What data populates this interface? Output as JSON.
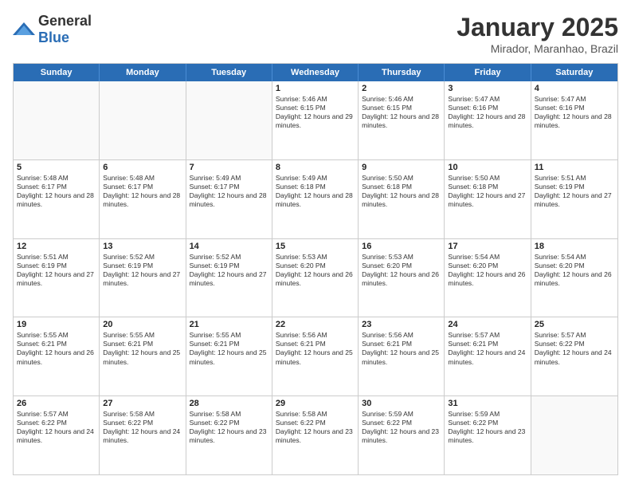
{
  "header": {
    "logo": {
      "general": "General",
      "blue": "Blue"
    },
    "title": "January 2025",
    "subtitle": "Mirador, Maranhao, Brazil"
  },
  "dayHeaders": [
    "Sunday",
    "Monday",
    "Tuesday",
    "Wednesday",
    "Thursday",
    "Friday",
    "Saturday"
  ],
  "weeks": [
    [
      {
        "day": "",
        "empty": true
      },
      {
        "day": "",
        "empty": true
      },
      {
        "day": "",
        "empty": true
      },
      {
        "day": "1",
        "sunrise": "5:46 AM",
        "sunset": "6:15 PM",
        "daylight": "12 hours and 29 minutes."
      },
      {
        "day": "2",
        "sunrise": "5:46 AM",
        "sunset": "6:15 PM",
        "daylight": "12 hours and 28 minutes."
      },
      {
        "day": "3",
        "sunrise": "5:47 AM",
        "sunset": "6:16 PM",
        "daylight": "12 hours and 28 minutes."
      },
      {
        "day": "4",
        "sunrise": "5:47 AM",
        "sunset": "6:16 PM",
        "daylight": "12 hours and 28 minutes."
      }
    ],
    [
      {
        "day": "5",
        "sunrise": "5:48 AM",
        "sunset": "6:17 PM",
        "daylight": "12 hours and 28 minutes."
      },
      {
        "day": "6",
        "sunrise": "5:48 AM",
        "sunset": "6:17 PM",
        "daylight": "12 hours and 28 minutes."
      },
      {
        "day": "7",
        "sunrise": "5:49 AM",
        "sunset": "6:17 PM",
        "daylight": "12 hours and 28 minutes."
      },
      {
        "day": "8",
        "sunrise": "5:49 AM",
        "sunset": "6:18 PM",
        "daylight": "12 hours and 28 minutes."
      },
      {
        "day": "9",
        "sunrise": "5:50 AM",
        "sunset": "6:18 PM",
        "daylight": "12 hours and 28 minutes."
      },
      {
        "day": "10",
        "sunrise": "5:50 AM",
        "sunset": "6:18 PM",
        "daylight": "12 hours and 27 minutes."
      },
      {
        "day": "11",
        "sunrise": "5:51 AM",
        "sunset": "6:19 PM",
        "daylight": "12 hours and 27 minutes."
      }
    ],
    [
      {
        "day": "12",
        "sunrise": "5:51 AM",
        "sunset": "6:19 PM",
        "daylight": "12 hours and 27 minutes."
      },
      {
        "day": "13",
        "sunrise": "5:52 AM",
        "sunset": "6:19 PM",
        "daylight": "12 hours and 27 minutes."
      },
      {
        "day": "14",
        "sunrise": "5:52 AM",
        "sunset": "6:19 PM",
        "daylight": "12 hours and 27 minutes."
      },
      {
        "day": "15",
        "sunrise": "5:53 AM",
        "sunset": "6:20 PM",
        "daylight": "12 hours and 26 minutes."
      },
      {
        "day": "16",
        "sunrise": "5:53 AM",
        "sunset": "6:20 PM",
        "daylight": "12 hours and 26 minutes."
      },
      {
        "day": "17",
        "sunrise": "5:54 AM",
        "sunset": "6:20 PM",
        "daylight": "12 hours and 26 minutes."
      },
      {
        "day": "18",
        "sunrise": "5:54 AM",
        "sunset": "6:20 PM",
        "daylight": "12 hours and 26 minutes."
      }
    ],
    [
      {
        "day": "19",
        "sunrise": "5:55 AM",
        "sunset": "6:21 PM",
        "daylight": "12 hours and 26 minutes."
      },
      {
        "day": "20",
        "sunrise": "5:55 AM",
        "sunset": "6:21 PM",
        "daylight": "12 hours and 25 minutes."
      },
      {
        "day": "21",
        "sunrise": "5:55 AM",
        "sunset": "6:21 PM",
        "daylight": "12 hours and 25 minutes."
      },
      {
        "day": "22",
        "sunrise": "5:56 AM",
        "sunset": "6:21 PM",
        "daylight": "12 hours and 25 minutes."
      },
      {
        "day": "23",
        "sunrise": "5:56 AM",
        "sunset": "6:21 PM",
        "daylight": "12 hours and 25 minutes."
      },
      {
        "day": "24",
        "sunrise": "5:57 AM",
        "sunset": "6:21 PM",
        "daylight": "12 hours and 24 minutes."
      },
      {
        "day": "25",
        "sunrise": "5:57 AM",
        "sunset": "6:22 PM",
        "daylight": "12 hours and 24 minutes."
      }
    ],
    [
      {
        "day": "26",
        "sunrise": "5:57 AM",
        "sunset": "6:22 PM",
        "daylight": "12 hours and 24 minutes."
      },
      {
        "day": "27",
        "sunrise": "5:58 AM",
        "sunset": "6:22 PM",
        "daylight": "12 hours and 24 minutes."
      },
      {
        "day": "28",
        "sunrise": "5:58 AM",
        "sunset": "6:22 PM",
        "daylight": "12 hours and 23 minutes."
      },
      {
        "day": "29",
        "sunrise": "5:58 AM",
        "sunset": "6:22 PM",
        "daylight": "12 hours and 23 minutes."
      },
      {
        "day": "30",
        "sunrise": "5:59 AM",
        "sunset": "6:22 PM",
        "daylight": "12 hours and 23 minutes."
      },
      {
        "day": "31",
        "sunrise": "5:59 AM",
        "sunset": "6:22 PM",
        "daylight": "12 hours and 23 minutes."
      },
      {
        "day": "",
        "empty": true
      }
    ]
  ]
}
